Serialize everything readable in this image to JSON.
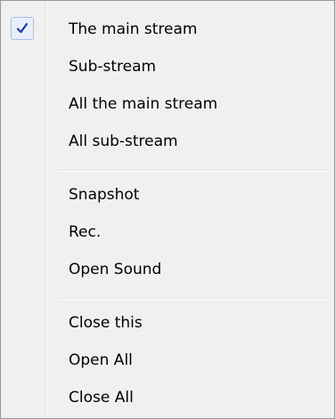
{
  "menu": {
    "items": [
      {
        "label": "The main stream",
        "checked": true
      },
      {
        "label": "Sub-stream",
        "checked": false
      },
      {
        "label": "All the main stream",
        "checked": false
      },
      {
        "label": "All sub-stream",
        "checked": false
      },
      {
        "label": "Snapshot",
        "checked": false
      },
      {
        "label": "Rec.",
        "checked": false
      },
      {
        "label": "Open Sound",
        "checked": false
      },
      {
        "label": "Close this",
        "checked": false
      },
      {
        "label": "Open All",
        "checked": false
      },
      {
        "label": "Close All",
        "checked": false
      }
    ],
    "check_icon": "checkmark-icon",
    "colors": {
      "background": "#f0f0f0",
      "border": "#979797",
      "check_color": "#1a3e9e",
      "check_bg": "#e8eefc"
    }
  }
}
